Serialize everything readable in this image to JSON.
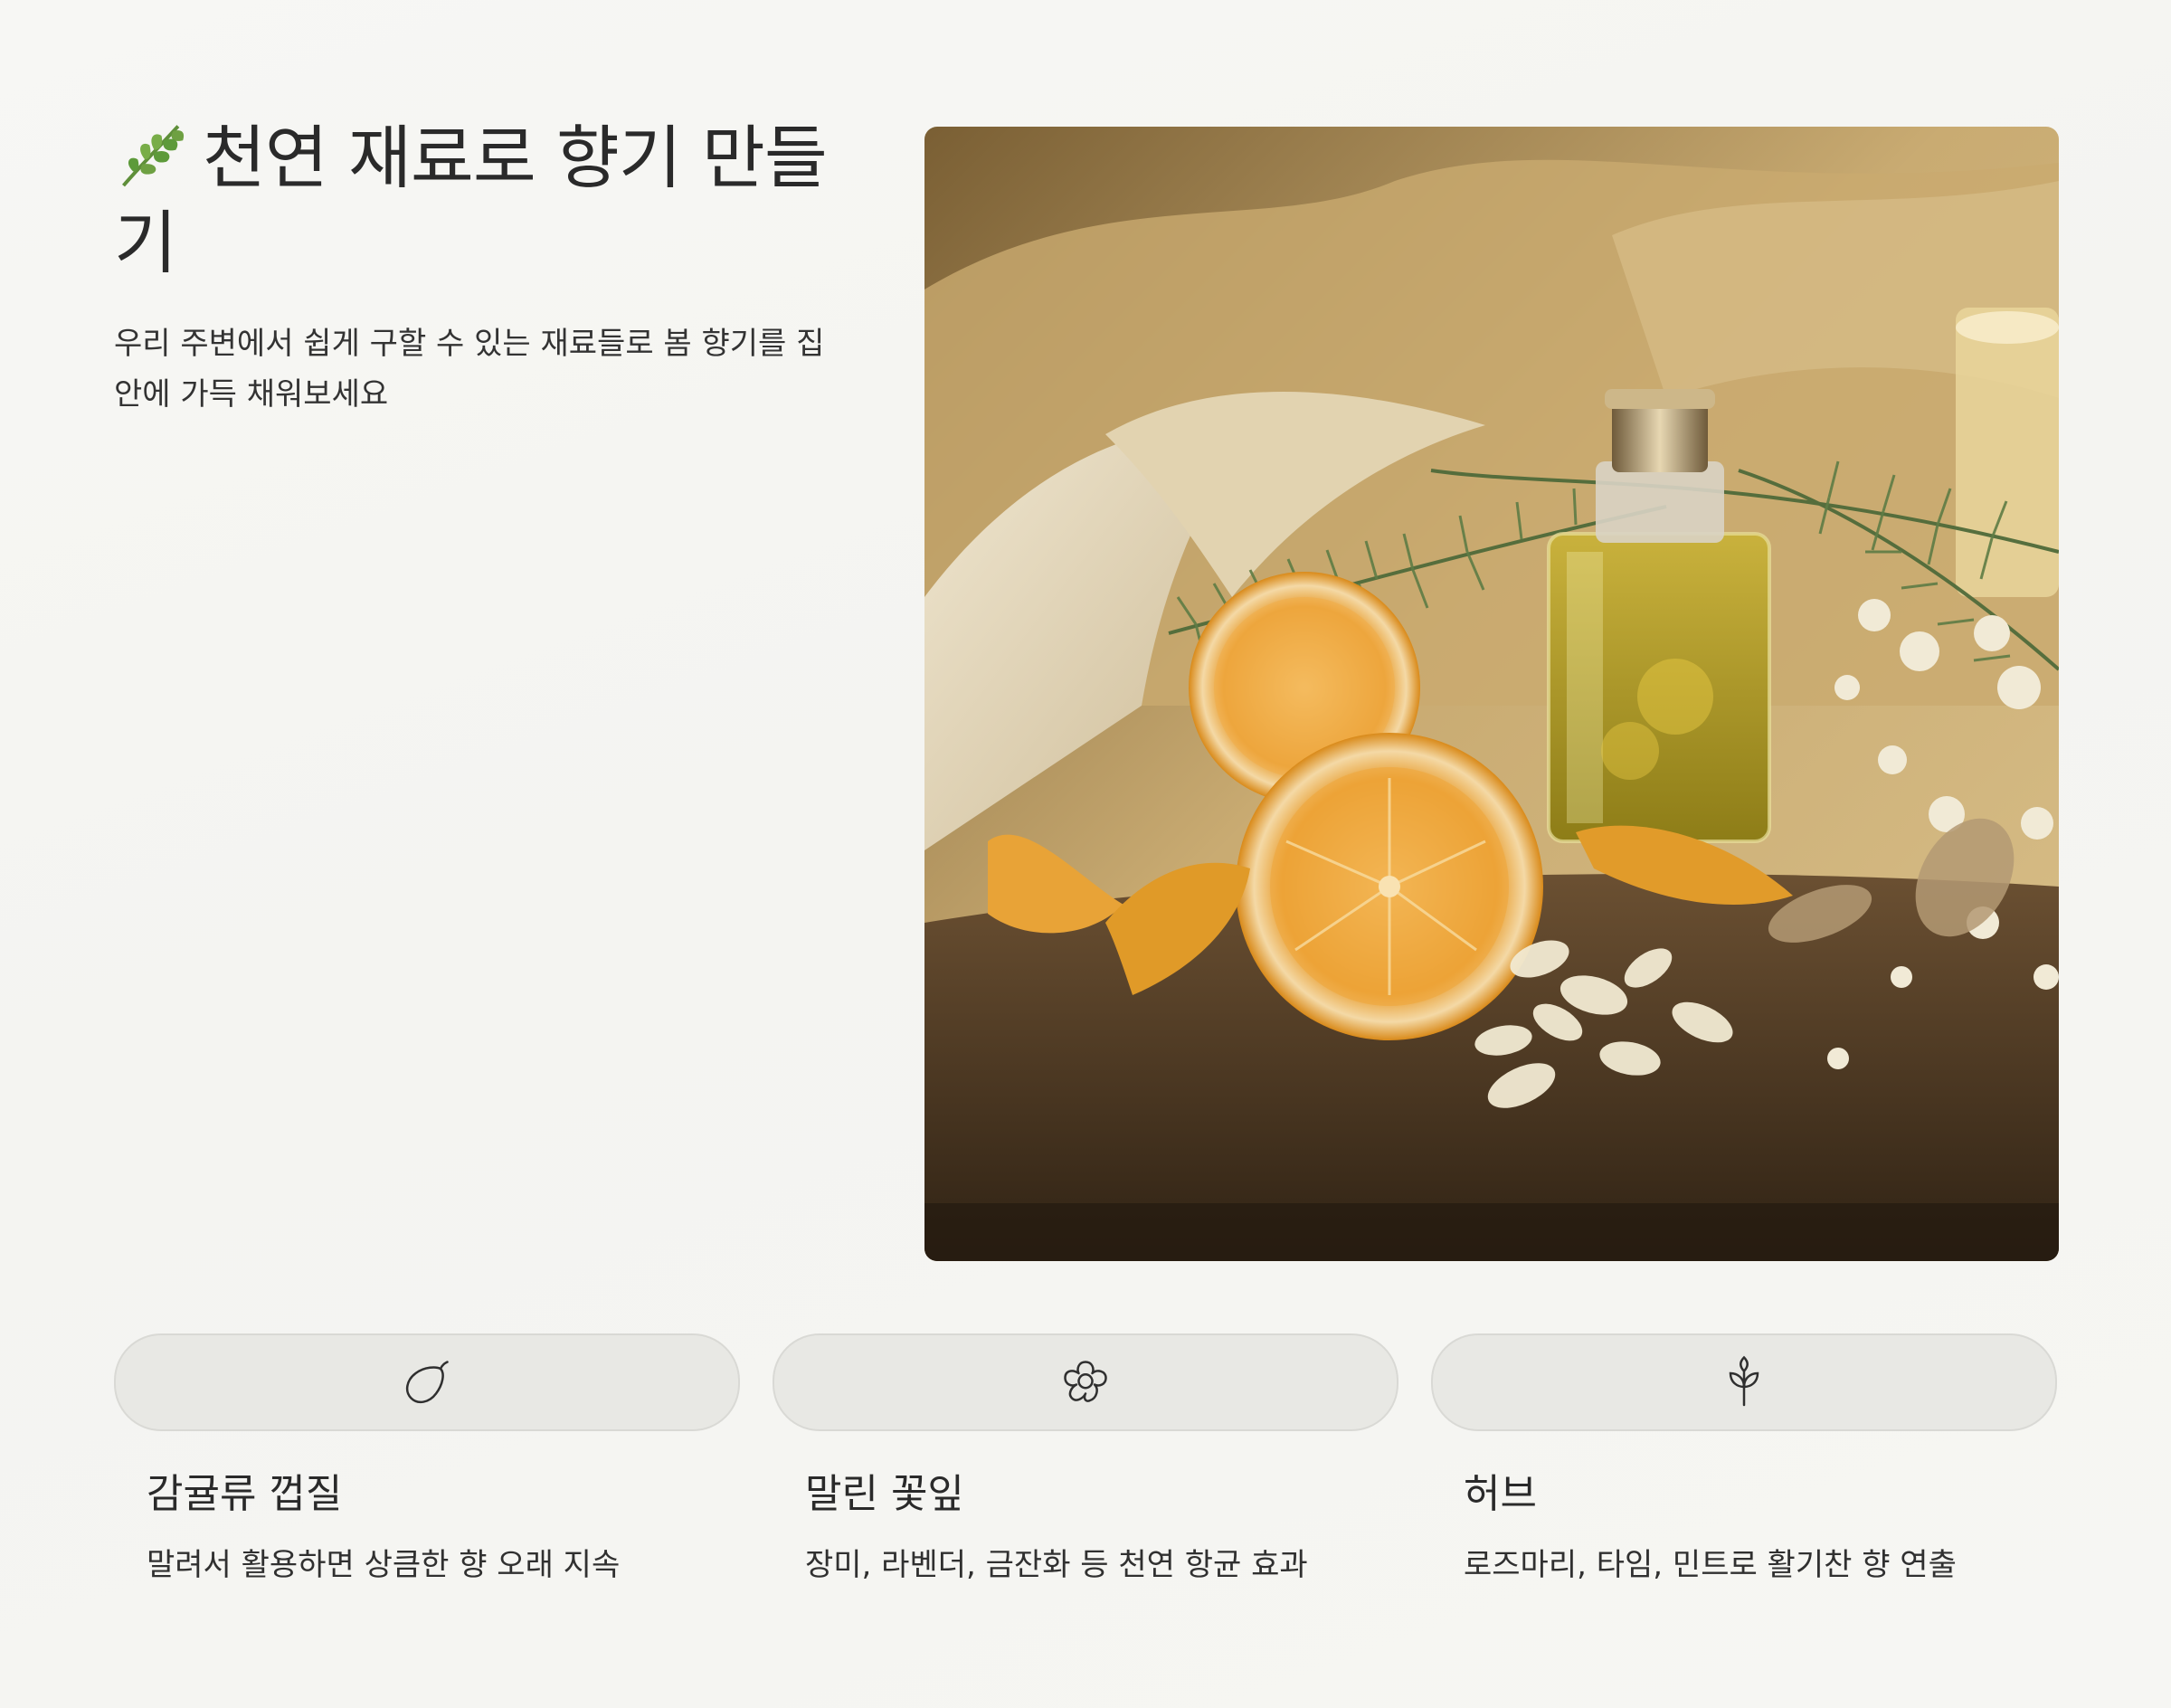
{
  "header": {
    "icon": "herb-leaf-icon",
    "title": "천연 재료로 향기 만들기",
    "subtitle": "우리 주변에서 쉽게 구할 수 있는 재료들로 봄 향기를 집 안에 가득 채워보세요"
  },
  "hero": {
    "icon": "perfume-citrus-photo"
  },
  "cards": [
    {
      "icon": "lemon-icon",
      "title": "감귤류 껍질",
      "description": "말려서 활용하면 상큼한 향 오래 지속"
    },
    {
      "icon": "flower-icon",
      "title": "말린 꽃잎",
      "description": "장미, 라벤더, 금잔화 등 천연 항균 효과"
    },
    {
      "icon": "sprout-icon",
      "title": "허브",
      "description": "로즈마리, 타임, 민트로 활기찬 향 연출"
    }
  ],
  "colors": {
    "background": "#f6f6f3",
    "pill": "#e8e8e4",
    "text": "#2a2a2a"
  }
}
